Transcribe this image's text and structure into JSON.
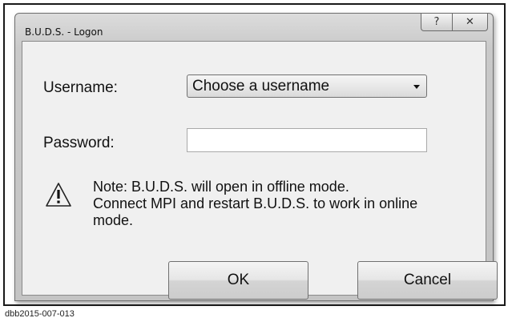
{
  "window": {
    "title": "B.U.D.S. - Logon",
    "help_glyph": "?",
    "close_glyph": "✕",
    "help_icon": "help-icon",
    "close_icon": "close-icon"
  },
  "form": {
    "username_label": "Username:",
    "username_value": "Choose a username",
    "password_label": "Password:",
    "password_value": ""
  },
  "note": {
    "icon": "warning-icon",
    "lines": [
      "Note: B.U.D.S. will open in offline mode.",
      "Connect MPI and restart B.U.D.S. to work in online",
      "mode."
    ]
  },
  "buttons": {
    "ok_label": "OK",
    "cancel_label": "Cancel"
  },
  "caption": "dbb2015-007-013"
}
